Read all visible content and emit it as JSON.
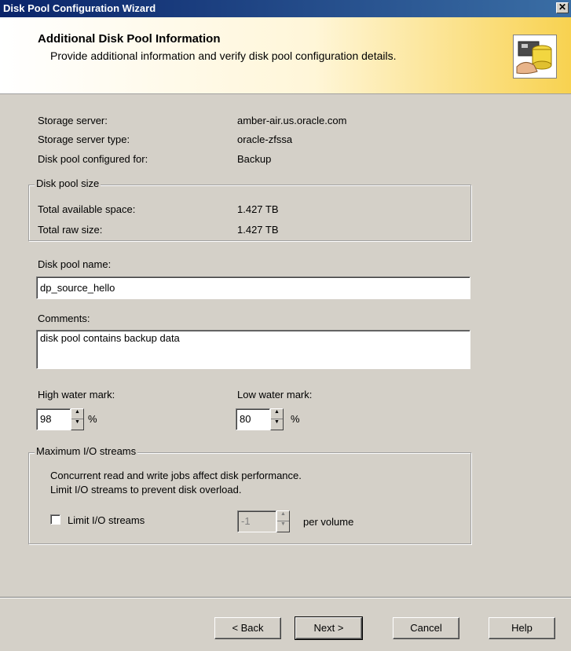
{
  "window": {
    "title": "Disk Pool Configuration Wizard",
    "close_glyph": "✕"
  },
  "header": {
    "title": "Additional Disk Pool Information",
    "subtitle": "Provide additional information and verify disk pool configuration details.",
    "icon": "disk-pool-wizard-icon"
  },
  "info": {
    "storage_server_label": "Storage server:",
    "storage_server_value": "amber-air.us.oracle.com",
    "server_type_label": "Storage server type:",
    "server_type_value": "oracle-zfssa",
    "configured_for_label": "Disk pool configured for:",
    "configured_for_value": "Backup"
  },
  "pool_size": {
    "group_title": "Disk pool size",
    "available_label": "Total available space:",
    "available_value": "1.427 TB",
    "raw_label": "Total raw size:",
    "raw_value": "1.427 TB"
  },
  "pool_name": {
    "label": "Disk pool name:",
    "value": "dp_source_hello"
  },
  "comments": {
    "label": "Comments:",
    "value": "disk pool contains backup data"
  },
  "water": {
    "high_label": "High water mark:",
    "high_value": "98",
    "low_label": "Low water mark:",
    "low_value": "80",
    "percent": "%"
  },
  "io": {
    "group_title": "Maximum I/O streams",
    "desc_line1": "Concurrent read and write jobs affect disk performance.",
    "desc_line2": "Limit I/O streams to prevent disk overload.",
    "checkbox_label": "Limit I/O streams",
    "checked": false,
    "streams_value": "-1",
    "per_volume": "per volume"
  },
  "buttons": {
    "back": "< Back",
    "next": "Next >",
    "cancel": "Cancel",
    "help": "Help"
  }
}
